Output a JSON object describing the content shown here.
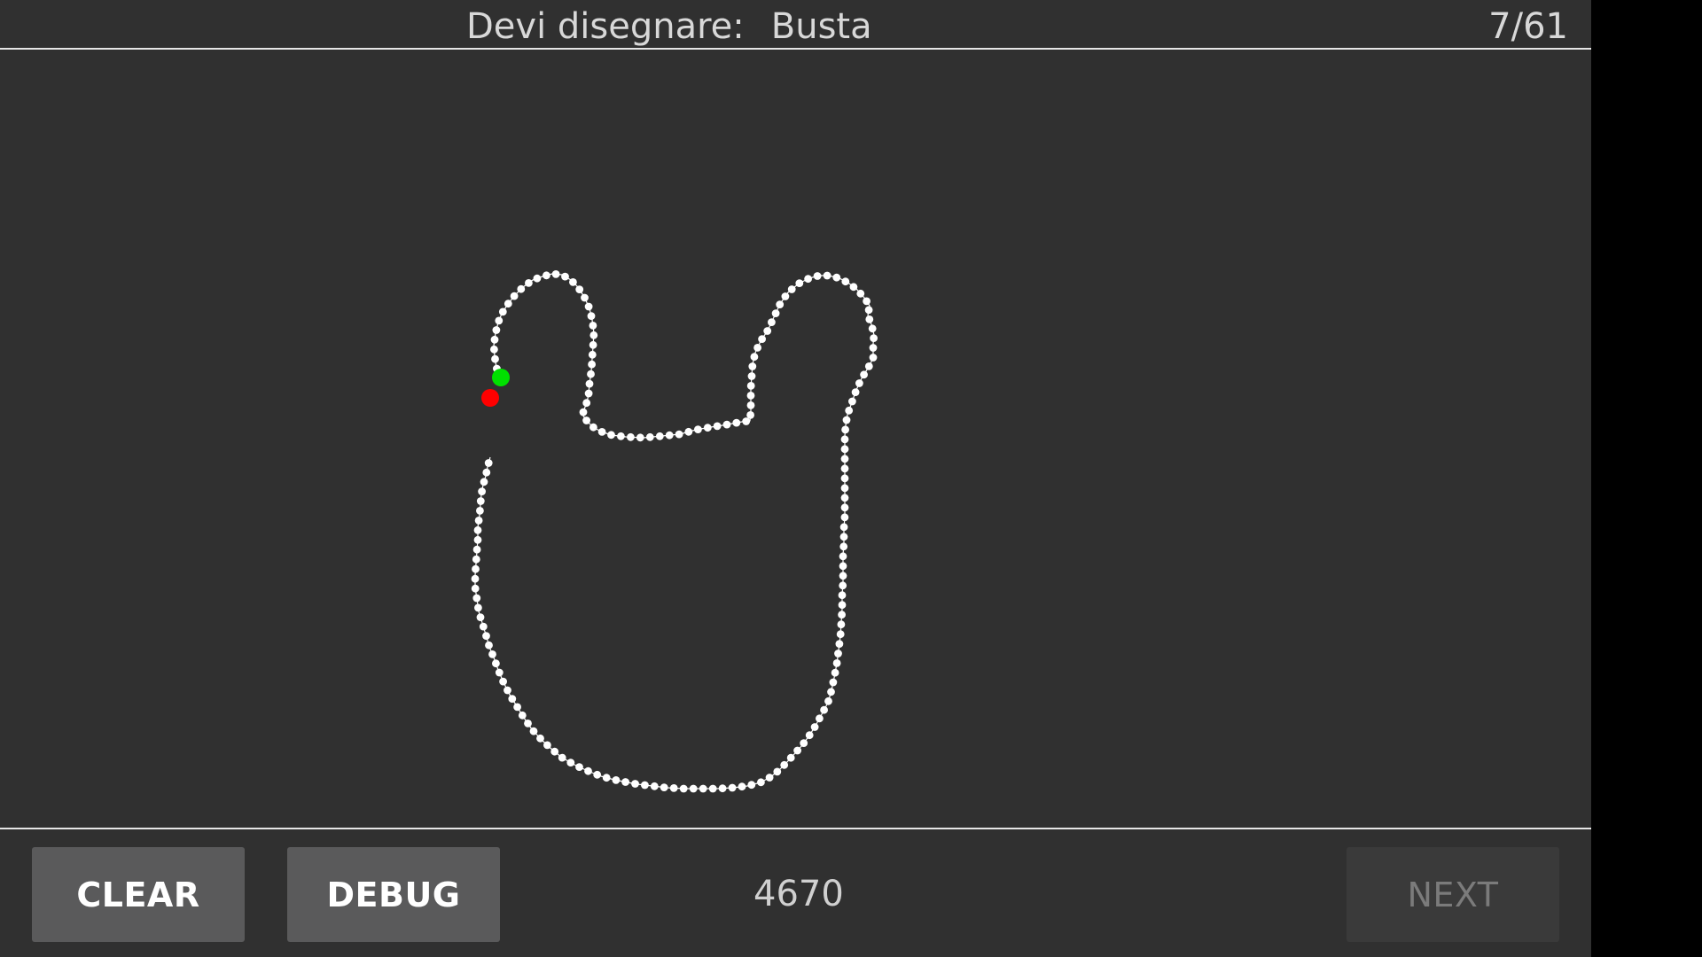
{
  "header": {
    "prompt_label": "Devi disegnare:",
    "target_word": "Busta",
    "progress": "7/61"
  },
  "footer": {
    "clear_label": "CLEAR",
    "debug_label": "DEBUG",
    "score": "4670",
    "next_label": "NEXT"
  },
  "colors": {
    "background": "#303030",
    "stroke": "#ffffff",
    "start_marker": "#00e000",
    "end_marker": "#ff0000",
    "button": "#5a5a5b",
    "button_disabled": "#3a3a3a"
  }
}
